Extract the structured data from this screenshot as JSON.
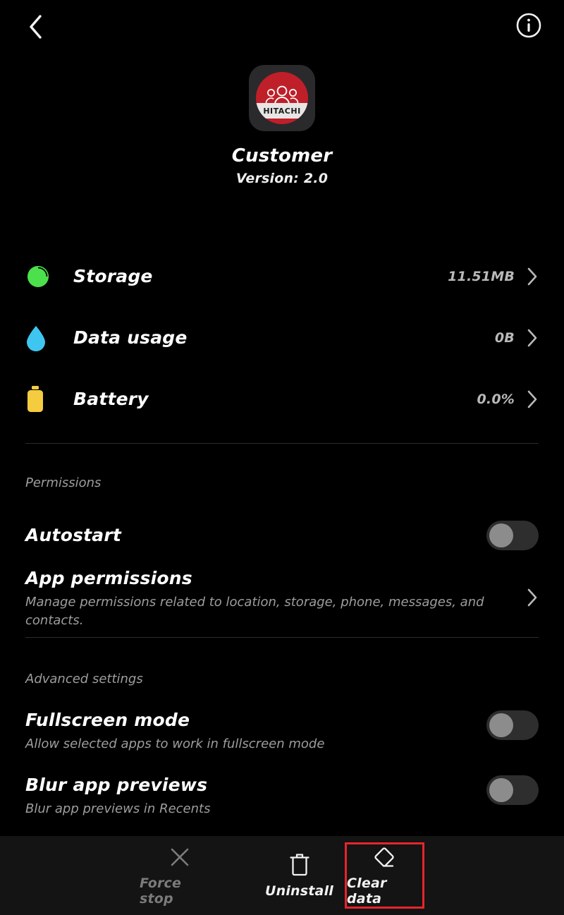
{
  "topbar": {
    "back_icon": "chevron-left-icon",
    "info_icon": "info-circle-icon"
  },
  "app": {
    "name": "Customer",
    "version": "Version: 2.0",
    "icon": {
      "name": "hitachi-customer-app-icon",
      "brand_text": "HITACHI",
      "circle_color": "#bf1f29",
      "band_color": "#e8e6e4",
      "tile_color": "#2a2a2c",
      "glyph": "people-group-icon"
    }
  },
  "info_rows": [
    {
      "icon": "pie-chart-icon",
      "icon_color": "#4ce04c",
      "label": "Storage",
      "value": "11.51MB"
    },
    {
      "icon": "water-drop-icon",
      "icon_color": "#3fc6f0",
      "label": "Data usage",
      "value": "0B"
    },
    {
      "icon": "battery-icon",
      "icon_color": "#f5cc3f",
      "label": "Battery",
      "value": "0.0%"
    }
  ],
  "sections": {
    "permissions": {
      "title": "Permissions",
      "autostart": {
        "label": "Autostart",
        "state": "off"
      },
      "app_permissions": {
        "label": "App permissions",
        "description": "Manage permissions related to location, storage, phone, messages, and contacts."
      }
    },
    "advanced": {
      "title": "Advanced settings",
      "fullscreen": {
        "label": "Fullscreen mode",
        "description": "Allow selected apps to work in fullscreen mode",
        "state": "off"
      },
      "blur": {
        "label": "Blur app previews",
        "description": "Blur app previews in Recents",
        "state": "off"
      }
    }
  },
  "bottom_actions": [
    {
      "label": "Force stop",
      "icon": "close-x-icon",
      "enabled": false,
      "highlighted": false
    },
    {
      "label": "Uninstall",
      "icon": "trash-icon",
      "enabled": true,
      "highlighted": false
    },
    {
      "label": "Clear data",
      "icon": "eraser-icon",
      "enabled": true,
      "highlighted": true
    }
  ],
  "highlight_color": "#e8242b"
}
